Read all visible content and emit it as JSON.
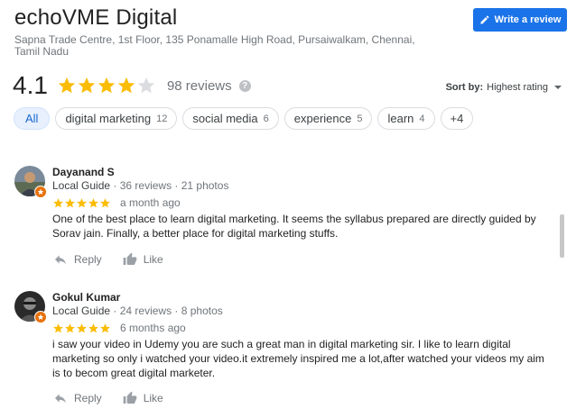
{
  "business": {
    "name": "echoVME Digital",
    "address": "Sapna Trade Centre, 1st Floor, 135 Ponamalle High Road, Pursaiwalkam, Chennai, Tamil Nadu",
    "rating": "4.1",
    "rating_value": 4.1,
    "review_count": "98 reviews"
  },
  "write_review": {
    "label": "Write a review"
  },
  "sort": {
    "label": "Sort by:",
    "value": "Highest rating"
  },
  "chips": [
    {
      "label": "All",
      "count": ""
    },
    {
      "label": "digital marketing",
      "count": "12"
    },
    {
      "label": "social media",
      "count": "6"
    },
    {
      "label": "experience",
      "count": "5"
    },
    {
      "label": "learn",
      "count": "4"
    },
    {
      "label": "+4",
      "count": ""
    }
  ],
  "reviews": [
    {
      "name": "Dayanand S",
      "guide": "Local Guide",
      "meta": " · 36 reviews · 21 photos",
      "stars": 5,
      "date": "a month ago",
      "text": "One of the best place to learn digital marketing. It seems the syllabus prepared are directly guided by Sorav jain. Finally, a better place for digital marketing stuffs.",
      "reply": "Reply",
      "like": "Like"
    },
    {
      "name": "Gokul Kumar",
      "guide": "Local Guide",
      "meta": " · 24 reviews · 8 photos",
      "stars": 5,
      "date": "6 months ago",
      "text": "i saw your video in Udemy you are such a great man in digital marketing sir. I like to learn digital marketing so only i watched your video.it extremely inspired me a lot,after watched your videos my aim is to becom great digital marketer.",
      "reply": "Reply",
      "like": "Like"
    }
  ],
  "colors": {
    "star": "#fbbc04",
    "star_empty": "#dadce0",
    "accent": "#1a73e8",
    "badge": "#e8710a"
  }
}
